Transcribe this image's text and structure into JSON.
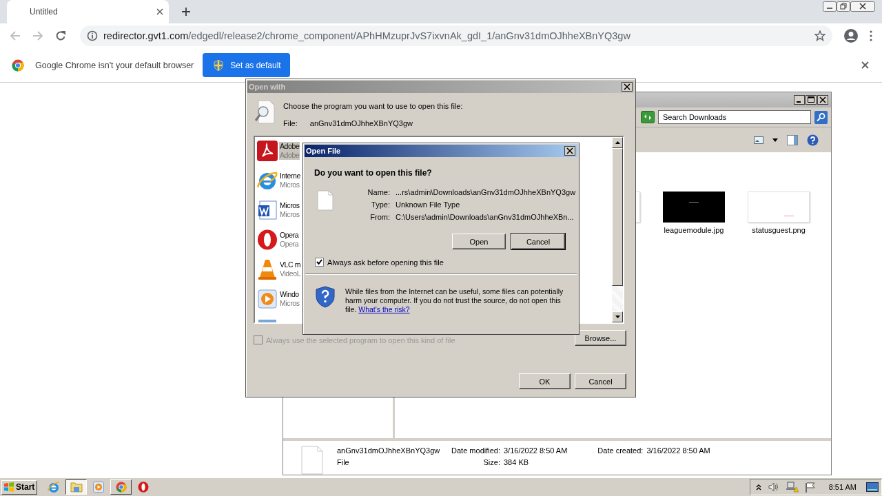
{
  "browser": {
    "tab": {
      "title": "Untitled"
    },
    "url": {
      "host": "redirector.gvt1.com",
      "path": "/edgedl/release2/chrome_component/APhHMzuprJvS7ixvnAk_gdI_1/anGnv31dmOJhheXBnYQ3gw"
    },
    "infobar": {
      "message": "Google Chrome isn't your default browser",
      "button": "Set as default"
    }
  },
  "explorer": {
    "search": {
      "placeholder": "Search Downloads"
    },
    "thumbnails": [
      {
        "kind": "light"
      },
      {
        "kind": "dark",
        "name": "leaguemodule.jpg"
      },
      {
        "kind": "light",
        "name": "statusguest.png"
      }
    ],
    "details": {
      "name": "anGnv31dmOJhheXBnYQ3gw",
      "type": "File",
      "fields": [
        {
          "label": "Date modified:",
          "value": "3/16/2022 8:50 AM"
        },
        {
          "label": "Size:",
          "value": "384 KB"
        },
        {
          "label": "Date created:",
          "value": "3/16/2022 8:50 AM"
        }
      ]
    }
  },
  "open_with": {
    "title": "Open with",
    "prompt": "Choose the program you want to use to open this file:",
    "file_label": "File:",
    "file_name": "anGnv31dmOJhheXBnYQ3gw",
    "programs": [
      {
        "kind": "pdf",
        "name": "Adobe",
        "publisher": "Adobe",
        "selected": true
      },
      {
        "kind": "ie",
        "name": "Interne",
        "publisher": "Micros",
        "selected": false
      },
      {
        "kind": "word",
        "name": "Micros",
        "publisher": "Micros",
        "selected": false
      },
      {
        "kind": "opera",
        "name": "Opera",
        "publisher": "Opera",
        "selected": false
      },
      {
        "kind": "vlc",
        "name": "VLC m",
        "publisher": "VideoL",
        "selected": false
      },
      {
        "kind": "wmp",
        "name": "Windo",
        "publisher": "Micros",
        "selected": false
      },
      {
        "kind": "wordpad",
        "selected": false
      }
    ],
    "always_use": {
      "label": "Always use the selected program to open this kind of file",
      "checked": false,
      "disabled": true
    },
    "browse": "Browse...",
    "ok": "OK",
    "cancel": "Cancel"
  },
  "open_file": {
    "title": "Open File",
    "question": "Do you want to open this file?",
    "fields": [
      {
        "label": "Name:",
        "value": "...rs\\admin\\Downloads\\anGnv31dmOJhheXBnYQ3gw"
      },
      {
        "label": "Type:",
        "value": "Unknown File Type"
      },
      {
        "label": "From:",
        "value": "C:\\Users\\admin\\Downloads\\anGnv31dmOJhheXBn..."
      }
    ],
    "buttons": [
      {
        "label": "Open",
        "default": false
      },
      {
        "label": "Cancel",
        "default": true
      }
    ],
    "always_ask": {
      "label": "Always ask before opening this file",
      "checked": true
    },
    "warning": {
      "text": "While files from the Internet can be useful, some files can potentially harm your computer. If you do not trust the source, do not open this file.",
      "link": "What's the risk?"
    }
  },
  "taskbar": {
    "start": "Start",
    "apps": [
      {
        "kind": "ie",
        "selected": false,
        "running": false
      },
      {
        "kind": "explorer",
        "selected": true,
        "running": true
      },
      {
        "kind": "mediaplayer",
        "selected": false,
        "running": false
      },
      {
        "kind": "chrome",
        "selected": false,
        "running": true
      },
      {
        "kind": "opera",
        "selected": false,
        "running": false
      }
    ],
    "clock": "8:51 AM"
  }
}
